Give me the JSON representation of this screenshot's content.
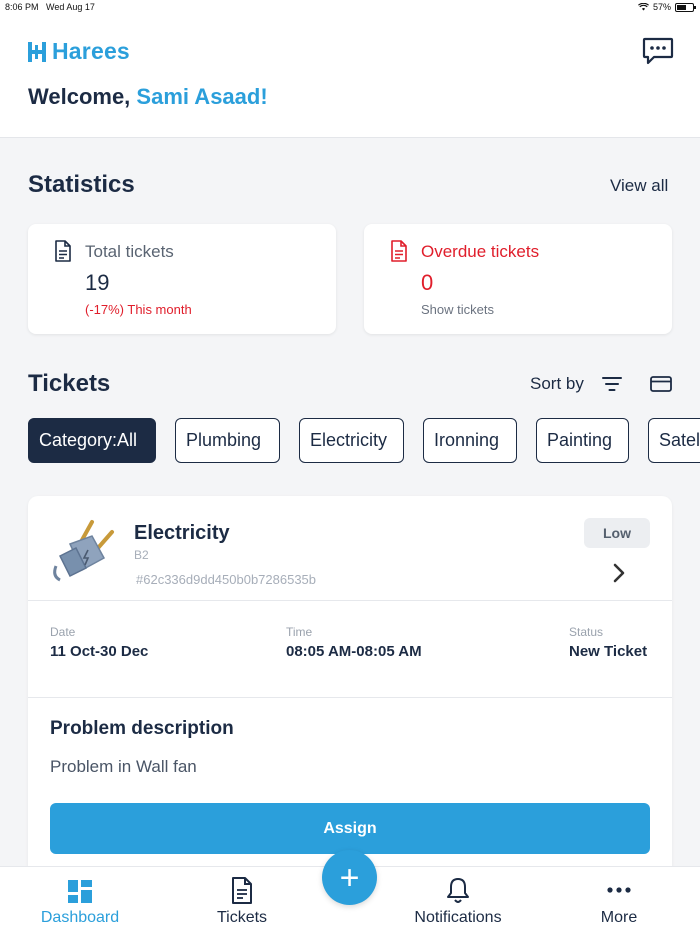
{
  "statusbar": {
    "time": "8:06 PM",
    "date": "Wed Aug 17",
    "battery": "57%",
    "battery_level": 0.57
  },
  "header": {
    "brand": "Harees",
    "welcome_prefix": "Welcome, ",
    "user_name": "Sami Asaad!"
  },
  "statistics": {
    "title": "Statistics",
    "view_all": "View all",
    "total": {
      "label": "Total tickets",
      "value": "19",
      "sub": "(-17%) This month"
    },
    "overdue": {
      "label": "Overdue tickets",
      "value": "0",
      "sub": "Show tickets"
    }
  },
  "tickets": {
    "title": "Tickets",
    "sort_by": "Sort by",
    "categories": [
      "Category:All",
      "Plumbing",
      "Electricity",
      "Ironning",
      "Painting",
      "Satel"
    ],
    "active_category": 0,
    "card": {
      "title": "Electricity",
      "subtitle": "B2",
      "id": "#62c336d9dd450b0b7286535b",
      "priority": "Low",
      "date_label": "Date",
      "date": "11 Oct-30 Dec",
      "time_label": "Time",
      "time": "08:05 AM-08:05 AM",
      "status_label": "Status",
      "status": "New Ticket",
      "problem_title": "Problem description",
      "problem_text": "Problem in Wall fan",
      "assign_label": "Assign"
    }
  },
  "tabbar": {
    "dashboard": "Dashboard",
    "tickets": "Tickets",
    "add": "+",
    "notifications": "Notifications",
    "more": "More"
  },
  "colors": {
    "brand": "#2b9fdb",
    "navy": "#1c2b44",
    "danger": "#e01e2b"
  }
}
